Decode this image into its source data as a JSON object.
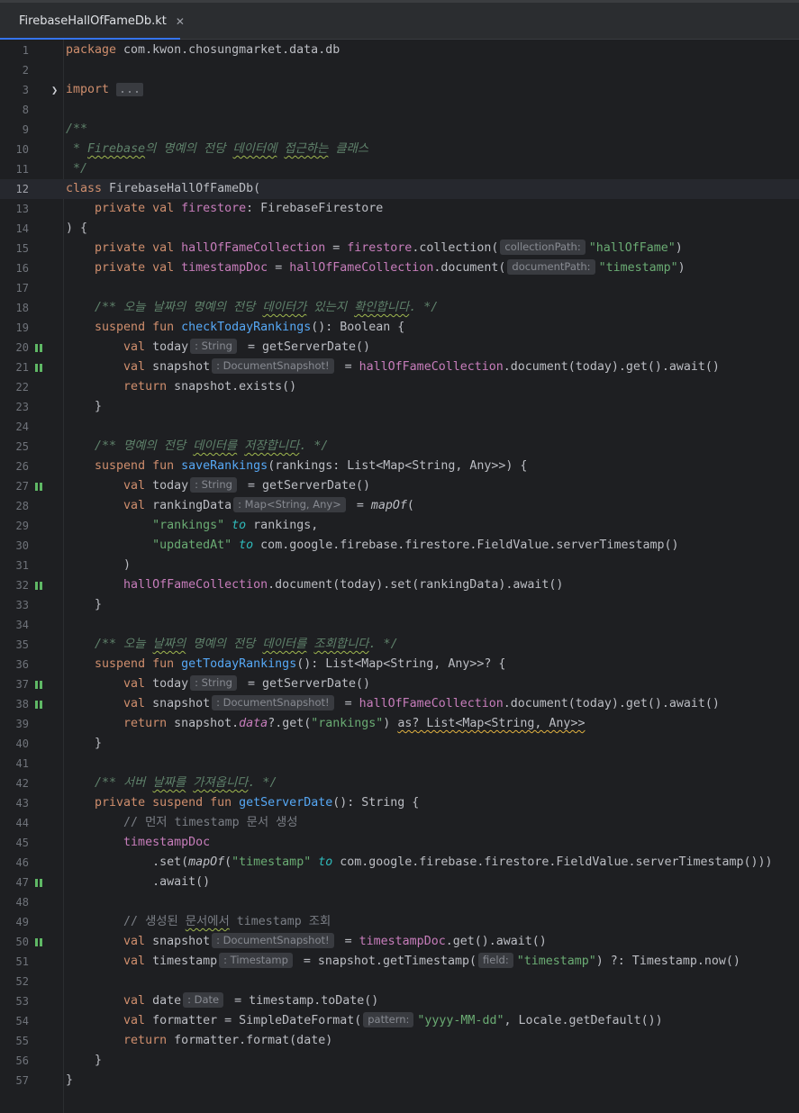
{
  "tab": {
    "filename": "FirebaseHallOfFameDb.kt",
    "close_glyph": "✕",
    "icon": "kotlin-class-icon"
  },
  "colors": {
    "tab_underline": "#3574f0",
    "change_marker": "#5fb865",
    "background": "#1e1f22"
  },
  "editor": {
    "current_line": 12,
    "lines": [
      {
        "n": "1",
        "marker": false
      },
      {
        "n": "2",
        "marker": false
      },
      {
        "n": "3",
        "marker": false
      },
      {
        "n": "8",
        "marker": false
      },
      {
        "n": "9",
        "marker": false
      },
      {
        "n": "10",
        "marker": false
      },
      {
        "n": "11",
        "marker": false
      },
      {
        "n": "12",
        "marker": false
      },
      {
        "n": "13",
        "marker": false
      },
      {
        "n": "14",
        "marker": false
      },
      {
        "n": "15",
        "marker": false
      },
      {
        "n": "16",
        "marker": false
      },
      {
        "n": "17",
        "marker": false
      },
      {
        "n": "18",
        "marker": false
      },
      {
        "n": "19",
        "marker": false
      },
      {
        "n": "20",
        "marker": true
      },
      {
        "n": "21",
        "marker": true
      },
      {
        "n": "22",
        "marker": false
      },
      {
        "n": "23",
        "marker": false
      },
      {
        "n": "24",
        "marker": false
      },
      {
        "n": "25",
        "marker": false
      },
      {
        "n": "26",
        "marker": false
      },
      {
        "n": "27",
        "marker": true
      },
      {
        "n": "28",
        "marker": false
      },
      {
        "n": "29",
        "marker": false
      },
      {
        "n": "30",
        "marker": false
      },
      {
        "n": "31",
        "marker": false
      },
      {
        "n": "32",
        "marker": true
      },
      {
        "n": "33",
        "marker": false
      },
      {
        "n": "34",
        "marker": false
      },
      {
        "n": "35",
        "marker": false
      },
      {
        "n": "36",
        "marker": false
      },
      {
        "n": "37",
        "marker": true
      },
      {
        "n": "38",
        "marker": true
      },
      {
        "n": "39",
        "marker": false
      },
      {
        "n": "40",
        "marker": false
      },
      {
        "n": "41",
        "marker": false
      },
      {
        "n": "42",
        "marker": false
      },
      {
        "n": "43",
        "marker": false
      },
      {
        "n": "44",
        "marker": false
      },
      {
        "n": "45",
        "marker": false
      },
      {
        "n": "46",
        "marker": false
      },
      {
        "n": "47",
        "marker": true
      },
      {
        "n": "48",
        "marker": false
      },
      {
        "n": "49",
        "marker": false
      },
      {
        "n": "50",
        "marker": true
      },
      {
        "n": "51",
        "marker": false
      },
      {
        "n": "52",
        "marker": false
      },
      {
        "n": "53",
        "marker": false
      },
      {
        "n": "54",
        "marker": false
      },
      {
        "n": "55",
        "marker": false
      },
      {
        "n": "56",
        "marker": false
      },
      {
        "n": "57",
        "marker": false
      }
    ],
    "code": [
      [
        {
          "t": "package ",
          "c": "kw"
        },
        {
          "t": "com.kwon.chosungmarket.data.db"
        }
      ],
      [],
      [
        {
          "t": "import ",
          "c": "kw"
        },
        {
          "t": "...",
          "c": "folded"
        }
      ],
      [],
      [
        {
          "t": "/**",
          "c": "doc"
        }
      ],
      [
        {
          "t": " * ",
          "c": "doc"
        },
        {
          "t": "Firebase",
          "c": "doc wavy"
        },
        {
          "t": "의 명예의 전당 ",
          "c": "doc"
        },
        {
          "t": "데이터에",
          "c": "doc wavy"
        },
        {
          "t": " ",
          "c": "doc"
        },
        {
          "t": "접근하는",
          "c": "doc wavy"
        },
        {
          "t": " 클래스",
          "c": "doc"
        }
      ],
      [
        {
          "t": " */",
          "c": "doc"
        }
      ],
      [
        {
          "t": "class ",
          "c": "kw"
        },
        {
          "t": "FirebaseHallOfFameDb("
        }
      ],
      [
        {
          "t": "    "
        },
        {
          "t": "private ",
          "c": "kw"
        },
        {
          "t": "val ",
          "c": "kw"
        },
        {
          "t": "firestore",
          "c": "fld"
        },
        {
          "t": ": FirebaseFirestore"
        }
      ],
      [
        {
          "t": ") {"
        }
      ],
      [
        {
          "t": "    "
        },
        {
          "t": "private val ",
          "c": "kw"
        },
        {
          "t": "hallOfFameCollection",
          "c": "fld"
        },
        {
          "t": " = "
        },
        {
          "t": "firestore",
          "c": "fld"
        },
        {
          "t": ".collection("
        },
        {
          "h": "collectionPath:"
        },
        {
          "t": "\"hallOfFame\"",
          "c": "str"
        },
        {
          "t": ")"
        }
      ],
      [
        {
          "t": "    "
        },
        {
          "t": "private val ",
          "c": "kw"
        },
        {
          "t": "timestampDoc",
          "c": "fld"
        },
        {
          "t": " = "
        },
        {
          "t": "hallOfFameCollection",
          "c": "fld"
        },
        {
          "t": ".document("
        },
        {
          "h": "documentPath:"
        },
        {
          "t": "\"timestamp\"",
          "c": "str"
        },
        {
          "t": ")"
        }
      ],
      [],
      [
        {
          "t": "    "
        },
        {
          "t": "/** 오늘 날짜의 명예의 전당 ",
          "c": "doc"
        },
        {
          "t": "데이터가",
          "c": "doc wavy"
        },
        {
          "t": " 있는지 ",
          "c": "doc"
        },
        {
          "t": "확인합니다",
          "c": "doc wavy"
        },
        {
          "t": ". */",
          "c": "doc"
        }
      ],
      [
        {
          "t": "    "
        },
        {
          "t": "suspend fun ",
          "c": "kw"
        },
        {
          "t": "checkTodayRankings",
          "c": "fn"
        },
        {
          "t": "(): Boolean {"
        }
      ],
      [
        {
          "t": "        "
        },
        {
          "t": "val ",
          "c": "kw"
        },
        {
          "t": "today"
        },
        {
          "h": ": String"
        },
        {
          "t": " = getServerDate()"
        }
      ],
      [
        {
          "t": "        "
        },
        {
          "t": "val ",
          "c": "kw"
        },
        {
          "t": "snapshot"
        },
        {
          "h": ": DocumentSnapshot!"
        },
        {
          "t": " = "
        },
        {
          "t": "hallOfFameCollection",
          "c": "fld"
        },
        {
          "t": ".document(today).get().await()"
        }
      ],
      [
        {
          "t": "        "
        },
        {
          "t": "return ",
          "c": "kw"
        },
        {
          "t": "snapshot.exists()"
        }
      ],
      [
        {
          "t": "    }"
        }
      ],
      [],
      [
        {
          "t": "    "
        },
        {
          "t": "/** 명예의 전당 ",
          "c": "doc"
        },
        {
          "t": "데이터를",
          "c": "doc wavy"
        },
        {
          "t": " ",
          "c": "doc"
        },
        {
          "t": "저장합니다",
          "c": "doc wavy"
        },
        {
          "t": ". */",
          "c": "doc"
        }
      ],
      [
        {
          "t": "    "
        },
        {
          "t": "suspend fun ",
          "c": "kw"
        },
        {
          "t": "saveRankings",
          "c": "fn"
        },
        {
          "t": "(rankings: List<Map<String, Any>>) {"
        }
      ],
      [
        {
          "t": "        "
        },
        {
          "t": "val ",
          "c": "kw"
        },
        {
          "t": "today"
        },
        {
          "h": ": String"
        },
        {
          "t": " = getServerDate()"
        }
      ],
      [
        {
          "t": "        "
        },
        {
          "t": "val ",
          "c": "kw"
        },
        {
          "t": "rankingData"
        },
        {
          "h": ": Map<String, Any>"
        },
        {
          "t": " = "
        },
        {
          "t": "mapOf",
          "c": "it"
        },
        {
          "t": "("
        }
      ],
      [
        {
          "t": "            "
        },
        {
          "t": "\"rankings\"",
          "c": "str"
        },
        {
          "t": " "
        },
        {
          "t": "to",
          "c": "inf"
        },
        {
          "t": " rankings,"
        }
      ],
      [
        {
          "t": "            "
        },
        {
          "t": "\"updatedAt\"",
          "c": "str"
        },
        {
          "t": " "
        },
        {
          "t": "to",
          "c": "inf"
        },
        {
          "t": " com.google.firebase.firestore.FieldValue.serverTimestamp()"
        }
      ],
      [
        {
          "t": "        )"
        }
      ],
      [
        {
          "t": "        "
        },
        {
          "t": "hallOfFameCollection",
          "c": "fld"
        },
        {
          "t": ".document(today).set(rankingData).await()"
        }
      ],
      [
        {
          "t": "    }"
        }
      ],
      [],
      [
        {
          "t": "    "
        },
        {
          "t": "/** 오늘 ",
          "c": "doc"
        },
        {
          "t": "날짜의",
          "c": "doc wavy"
        },
        {
          "t": " 명예의 전당 ",
          "c": "doc"
        },
        {
          "t": "데이터를",
          "c": "doc wavy"
        },
        {
          "t": " ",
          "c": "doc"
        },
        {
          "t": "조회합니다",
          "c": "doc wavy"
        },
        {
          "t": ". */",
          "c": "doc"
        }
      ],
      [
        {
          "t": "    "
        },
        {
          "t": "suspend fun ",
          "c": "kw"
        },
        {
          "t": "getTodayRankings",
          "c": "fn"
        },
        {
          "t": "(): List<Map<String, Any>>? {"
        }
      ],
      [
        {
          "t": "        "
        },
        {
          "t": "val ",
          "c": "kw"
        },
        {
          "t": "today"
        },
        {
          "h": ": String"
        },
        {
          "t": " = getServerDate()"
        }
      ],
      [
        {
          "t": "        "
        },
        {
          "t": "val ",
          "c": "kw"
        },
        {
          "t": "snapshot"
        },
        {
          "h": ": DocumentSnapshot!"
        },
        {
          "t": " = "
        },
        {
          "t": "hallOfFameCollection",
          "c": "fld"
        },
        {
          "t": ".document(today).get().await()"
        }
      ],
      [
        {
          "t": "        "
        },
        {
          "t": "return ",
          "c": "kw"
        },
        {
          "t": "snapshot."
        },
        {
          "t": "data",
          "c": "fld it"
        },
        {
          "t": "?.get("
        },
        {
          "t": "\"rankings\"",
          "c": "str"
        },
        {
          "t": ") "
        },
        {
          "t": "as? List<Map<String, Any>>",
          "c": "wavy-y"
        }
      ],
      [
        {
          "t": "    }"
        }
      ],
      [],
      [
        {
          "t": "    "
        },
        {
          "t": "/** 서버 ",
          "c": "doc"
        },
        {
          "t": "날짜를",
          "c": "doc wavy"
        },
        {
          "t": " ",
          "c": "doc"
        },
        {
          "t": "가져옵니다",
          "c": "doc wavy"
        },
        {
          "t": ". */",
          "c": "doc"
        }
      ],
      [
        {
          "t": "    "
        },
        {
          "t": "private suspend fun ",
          "c": "kw"
        },
        {
          "t": "getServerDate",
          "c": "fn"
        },
        {
          "t": "(): String {"
        }
      ],
      [
        {
          "t": "        "
        },
        {
          "t": "// 먼저 timestamp 문서 생성",
          "c": "cmt"
        }
      ],
      [
        {
          "t": "        "
        },
        {
          "t": "timestampDoc",
          "c": "fld"
        }
      ],
      [
        {
          "t": "            .set("
        },
        {
          "t": "mapOf",
          "c": "it"
        },
        {
          "t": "("
        },
        {
          "t": "\"timestamp\"",
          "c": "str"
        },
        {
          "t": " "
        },
        {
          "t": "to",
          "c": "inf"
        },
        {
          "t": " com.google.firebase.firestore.FieldValue.serverTimestamp()))"
        }
      ],
      [
        {
          "t": "            .await()"
        }
      ],
      [],
      [
        {
          "t": "        "
        },
        {
          "t": "// 생성된 ",
          "c": "cmt"
        },
        {
          "t": "문서에서",
          "c": "cmt wavy"
        },
        {
          "t": " timestamp 조회",
          "c": "cmt"
        }
      ],
      [
        {
          "t": "        "
        },
        {
          "t": "val ",
          "c": "kw"
        },
        {
          "t": "snapshot"
        },
        {
          "h": ": DocumentSnapshot!"
        },
        {
          "t": " = "
        },
        {
          "t": "timestampDoc",
          "c": "fld"
        },
        {
          "t": ".get().await()"
        }
      ],
      [
        {
          "t": "        "
        },
        {
          "t": "val ",
          "c": "kw"
        },
        {
          "t": "timestamp"
        },
        {
          "h": ": Timestamp"
        },
        {
          "t": " = snapshot.getTimestamp("
        },
        {
          "h": "field:"
        },
        {
          "t": "\"timestamp\"",
          "c": "str"
        },
        {
          "t": ") ?: Timestamp.now()"
        }
      ],
      [],
      [
        {
          "t": "        "
        },
        {
          "t": "val ",
          "c": "kw"
        },
        {
          "t": "date"
        },
        {
          "h": ": Date"
        },
        {
          "t": " = timestamp.toDate()"
        }
      ],
      [
        {
          "t": "        "
        },
        {
          "t": "val ",
          "c": "kw"
        },
        {
          "t": "formatter = SimpleDateFormat("
        },
        {
          "h": "pattern:"
        },
        {
          "t": "\"yyyy-MM-dd\"",
          "c": "str"
        },
        {
          "t": ", Locale.getDefault())"
        }
      ],
      [
        {
          "t": "        "
        },
        {
          "t": "return ",
          "c": "kw"
        },
        {
          "t": "formatter.format(date)"
        }
      ],
      [
        {
          "t": "    }"
        }
      ],
      [
        {
          "t": "}"
        }
      ]
    ]
  }
}
